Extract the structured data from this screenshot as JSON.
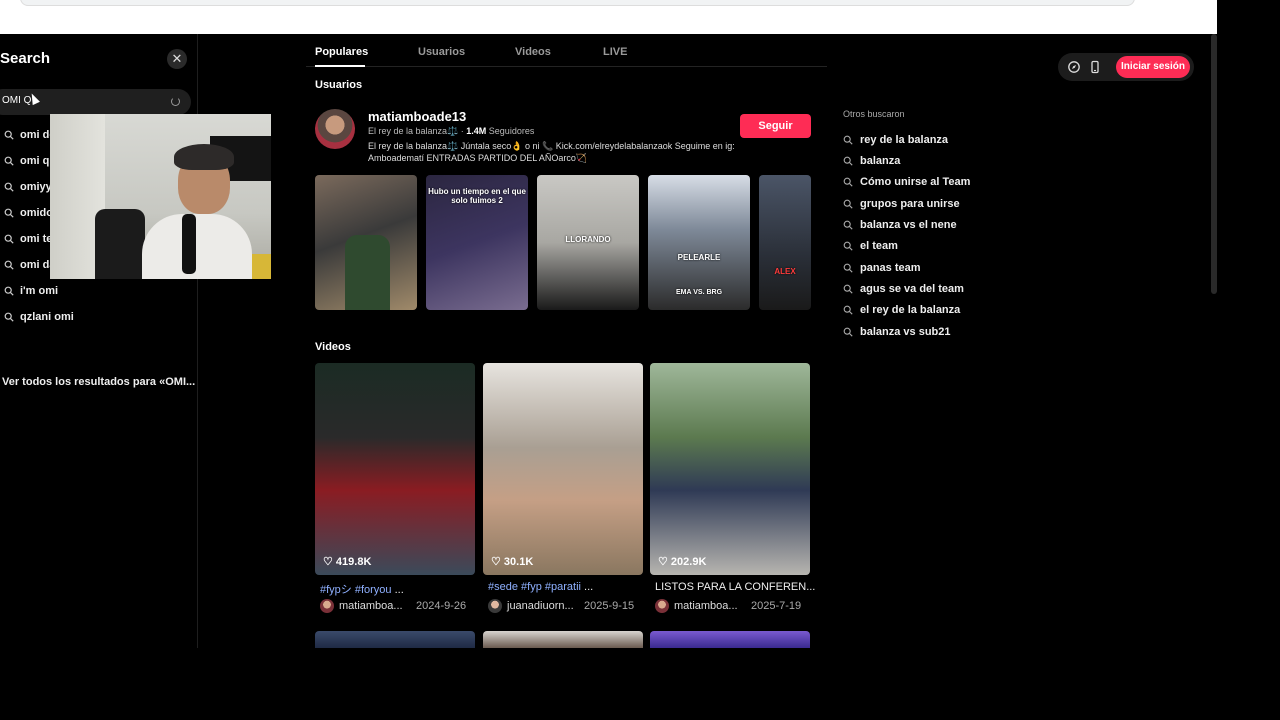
{
  "search": {
    "title": "Search",
    "query": "OMI Q",
    "suggestions": [
      "omi de",
      "omi qu",
      "omiyy",
      "omido",
      "omi te",
      "omi da",
      "i'm omi",
      "qzlani omi"
    ],
    "see_all": "Ver todos los resultados para «OMI..."
  },
  "tabs": [
    {
      "label": "Populares",
      "active": true
    },
    {
      "label": "Usuarios",
      "active": false
    },
    {
      "label": "Videos",
      "active": false
    },
    {
      "label": "LIVE",
      "active": false
    }
  ],
  "users_section": {
    "title": "Usuarios",
    "user": {
      "username": "matiamboade13",
      "nickname": "El rey de la balanza⚖️",
      "followers": "1.4M",
      "followers_label": "Seguidores",
      "bio": "El rey de la balanza⚖️ Júntala seco👌 o ni 📞 Kick.com/elreydelabalanzaok Seguime en ig: Amboadematí ENTRADAS PARTIDO DEL AÑOarco🏹",
      "follow_label": "Seguir"
    },
    "thumb_captions": [
      "",
      "Hubo un tiempo en el que solo fuimos 2",
      "LLORANDO",
      "PELEARLE",
      "ALEX"
    ],
    "thumb_bottom_captions": [
      "",
      "",
      "",
      "EMA  VS.  BRG",
      ""
    ]
  },
  "videos_section": {
    "title": "Videos",
    "videos": [
      {
        "likes": "419.8K",
        "caption_tags": "#fypシ #foryou",
        "caption_rest": " ...",
        "author": "matiamboa...",
        "date": "2024-9-26"
      },
      {
        "likes": "30.1K",
        "caption_tags": "#sede #fyp #paratii",
        "caption_rest": " ...",
        "author": "juanadiuorn...",
        "date": "2025-9-15"
      },
      {
        "likes": "202.9K",
        "caption_tags": "",
        "caption_rest": "LISTOS PARA LA CONFEREN...",
        "author": "matiamboa...",
        "date": "2025-7-19"
      }
    ]
  },
  "header": {
    "login_label": "Iniciar sesión",
    "icons": [
      "compass-icon",
      "mobile-icon"
    ]
  },
  "others": {
    "title": "Otros buscaron",
    "items": [
      "rey de la balanza",
      "balanza",
      "Cómo unirse al Team",
      "grupos para unirse",
      "balanza vs el nene",
      "el team",
      "panas team",
      "agus se va del team",
      "el rey de la balanza",
      "balanza vs sub21"
    ]
  },
  "colors": {
    "accent": "#fe2c55",
    "background": "#000000",
    "hashtag": "#8fb0ff"
  }
}
